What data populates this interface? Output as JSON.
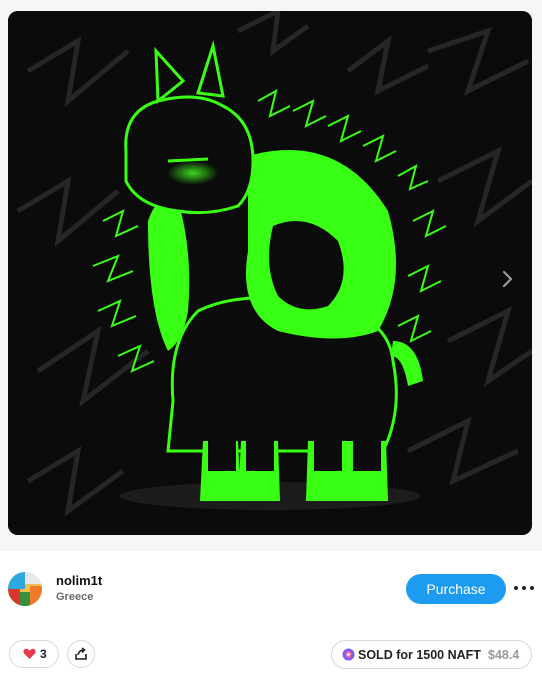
{
  "post": {
    "artwork_alt": "Neon green llama with lightning bolts",
    "next_icon": "chevron-right-icon"
  },
  "creator": {
    "username": "nolim1t",
    "location": "Greece",
    "avatar_icon": "avatar-icon"
  },
  "actions": {
    "purchase_label": "Purchase",
    "more_icon": "more-horizontal-icon",
    "like_count": "3",
    "like_icon": "heart-icon",
    "like_color": "#e53950",
    "share_icon": "share-icon",
    "sold_text": "SOLD for 1500 NAFT",
    "sold_usd": "$48.4",
    "token_icon": "naft-token-icon"
  },
  "colors": {
    "accent": "#1d9bf0",
    "neon": "#39ff14",
    "background": "#0a0a0a"
  }
}
